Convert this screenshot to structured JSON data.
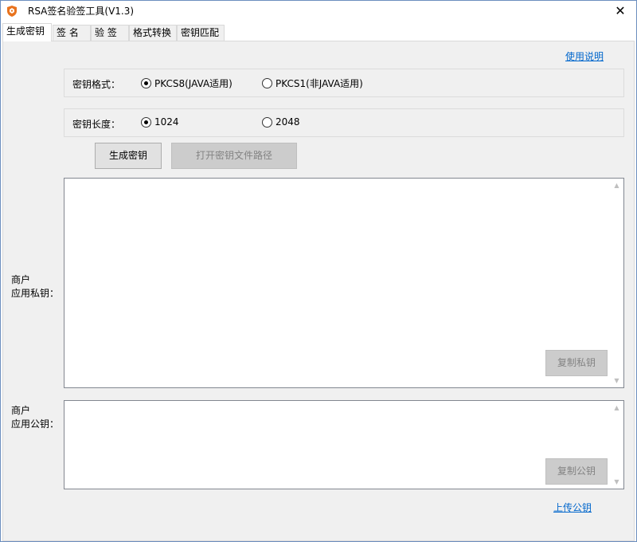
{
  "window": {
    "title": "RSA签名验签工具(V1.3)",
    "close_glyph": "✕"
  },
  "tabs": [
    {
      "label": "生成密钥",
      "active": true
    },
    {
      "label": "签 名",
      "active": false
    },
    {
      "label": "验 签",
      "active": false
    },
    {
      "label": "格式转换",
      "active": false
    },
    {
      "label": "密钥匹配",
      "active": false
    }
  ],
  "help_link": "使用说明",
  "key_format": {
    "label": "密钥格式：",
    "options": [
      "PKCS8(JAVA适用)",
      "PKCS1(非JAVA适用)"
    ],
    "selected": "PKCS8(JAVA适用)"
  },
  "key_length": {
    "label": "密钥长度：",
    "options": [
      "1024",
      "2048"
    ],
    "selected": "1024"
  },
  "buttons": {
    "generate": "生成密钥",
    "open_path": "打开密钥文件路径",
    "copy_private": "复制私钥",
    "copy_public": "复制公钥"
  },
  "private_key": {
    "label_line1": "商户",
    "label_line2": "应用私钥：",
    "value": ""
  },
  "public_key": {
    "label_line1": "商户",
    "label_line2": "应用公钥：",
    "value": ""
  },
  "upload_link": "上传公钥",
  "icons": {
    "app": "shield-logo-icon",
    "scroll_up": "▲",
    "scroll_down": "▼"
  },
  "colors": {
    "link": "#0066cc",
    "panel_bg": "#f0f0f0",
    "icon_orange": "#e8731e"
  }
}
